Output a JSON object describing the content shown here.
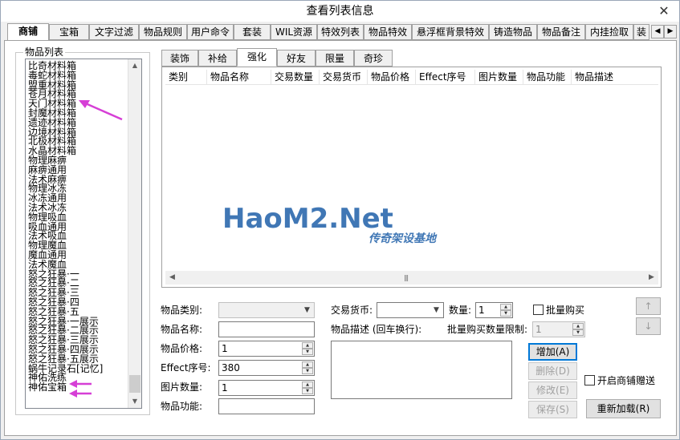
{
  "window": {
    "title": "查看列表信息",
    "close_glyph": "✕"
  },
  "main_tabs": [
    {
      "label": "商铺",
      "active": true
    },
    {
      "label": "宝箱"
    },
    {
      "label": "文字过滤"
    },
    {
      "label": "物品规则"
    },
    {
      "label": "用户命令"
    },
    {
      "label": "套装"
    },
    {
      "label": "WIL资源"
    },
    {
      "label": "特效列表"
    },
    {
      "label": "物品特效"
    },
    {
      "label": "悬浮框背景特效"
    },
    {
      "label": "铸造物品"
    },
    {
      "label": "物品备注"
    },
    {
      "label": "内挂捡取"
    },
    {
      "label": "装"
    }
  ],
  "item_group": {
    "label": "物品列表",
    "items": [
      "比奇材料箱",
      "毒蛇材料箱",
      "盟重材料箱",
      "苍月材料箱",
      "天门材料箱",
      "封魔材料箱",
      "遗迹材料箱",
      "边境材料箱",
      "北极材料箱",
      "水晶材料箱",
      "物理麻痹",
      "麻痹通用",
      "法术麻痹",
      "物理冰冻",
      "冰冻通用",
      "法术冰冻",
      "物理吸血",
      "吸血通用",
      "法术吸血",
      "物理魔血",
      "魔血通用",
      "法术魔血",
      "怒之狂暴·一",
      "怒之狂暴·二",
      "怒之狂暴·三",
      "怒之狂暴·四",
      "怒之狂暴·五",
      "怒之狂暴·一展示",
      "怒之狂暴·二展示",
      "怒之狂暴·三展示",
      "怒之狂暴·四展示",
      "怒之狂暴·五展示",
      "蜗牛记录石[记忆]",
      "神佑洗练",
      "神佑宝箱"
    ]
  },
  "sub_tabs": [
    {
      "label": "装饰"
    },
    {
      "label": "补给"
    },
    {
      "label": "强化",
      "active": true
    },
    {
      "label": "好友"
    },
    {
      "label": "限量"
    },
    {
      "label": "奇珍"
    }
  ],
  "list_columns": [
    "类别",
    "物品名称",
    "交易数量",
    "交易货币",
    "物品价格",
    "Effect序号",
    "图片数量",
    "物品功能",
    "物品描述"
  ],
  "form": {
    "category_label": "物品类别:",
    "category_value": "",
    "name_label": "物品名称:",
    "name_value": "",
    "price_label": "物品价格:",
    "price_value": "1",
    "effect_label": "Effect序号:",
    "effect_value": "380",
    "image_count_label": "图片数量:",
    "image_count_value": "1",
    "function_label": "物品功能:",
    "function_value": "",
    "currency_label": "交易货币:",
    "currency_value": "",
    "quantity_label": "数量:",
    "quantity_value": "1",
    "bulk_buy_label": "批量购买",
    "bulk_buy_checked": false,
    "desc_label": "物品描述 (回车换行):",
    "bulk_limit_label": "批量购买数量限制:",
    "bulk_limit_value": "1",
    "gift_label": "开启商铺赠送",
    "gift_checked": false
  },
  "buttons": {
    "add": "增加(A)",
    "delete": "删除(D)",
    "modify": "修改(E)",
    "save": "保存(S)",
    "reload": "重新加载(R)",
    "move_up": "↑",
    "move_down": "↓"
  },
  "watermark": {
    "text": "HaoM2.Net",
    "tagline": "传奇架设基地"
  }
}
